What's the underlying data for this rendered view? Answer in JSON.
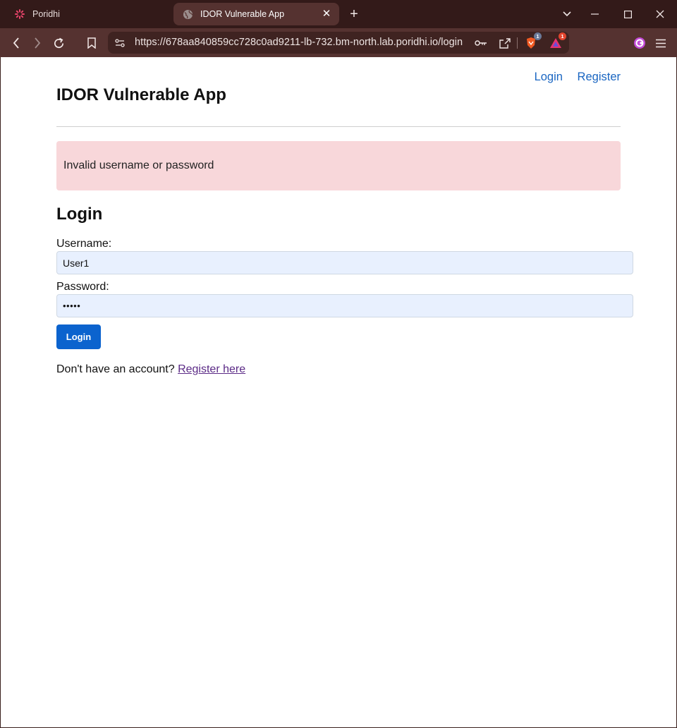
{
  "browser": {
    "tabs": [
      {
        "title": "Poridhi",
        "icon": "poridhi-spinner-icon",
        "active": false
      },
      {
        "title": "IDOR Vulnerable App",
        "icon": "globe-icon",
        "active": true
      }
    ],
    "url": "https://678aa840859cc728c0ad9211-lb-732.bm-north.lab.poridhi.io/login",
    "shields_badge": "1",
    "rewards_badge": "1",
    "colors": {
      "tabbar": "#331a19",
      "toolbar": "#553230"
    }
  },
  "app": {
    "title": "IDOR Vulnerable App",
    "nav": {
      "login": "Login",
      "register": "Register"
    },
    "alert": {
      "message": "Invalid username or password",
      "color": "#f8d7da"
    },
    "form": {
      "heading": "Login",
      "username_label": "Username:",
      "username_value": "User1",
      "password_label": "Password:",
      "password_value": "•••••",
      "submit_label": "Login",
      "register_prompt": "Don't have an account?",
      "register_link": "Register here"
    },
    "colors": {
      "accent": "#0b63ce",
      "link": "#1a66c2",
      "visited_link": "#5b2a86"
    }
  }
}
